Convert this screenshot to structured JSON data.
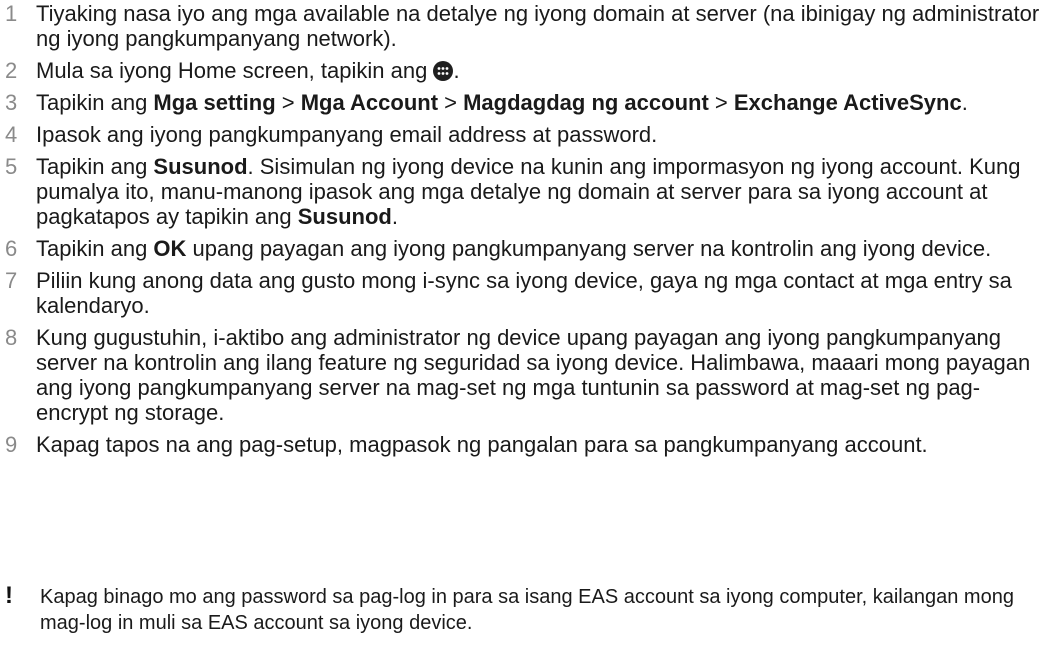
{
  "steps": [
    {
      "num": "1",
      "parts": [
        {
          "t": "Tiyaking nasa iyo ang mga available na detalye ng iyong domain at server (na ibinigay ng administrator ng iyong pangkumpanyang network)."
        }
      ]
    },
    {
      "num": "2",
      "parts": [
        {
          "t": "Mula sa iyong Home screen, tapikin ang "
        },
        {
          "icon": "apps-icon"
        },
        {
          "t": "."
        }
      ]
    },
    {
      "num": "3",
      "parts": [
        {
          "t": "Tapikin ang "
        },
        {
          "b": "Mga setting"
        },
        {
          "t": " > "
        },
        {
          "b": "Mga Account"
        },
        {
          "t": " > "
        },
        {
          "b": "Magdagdag ng account"
        },
        {
          "t": " > "
        },
        {
          "b": "Exchange ActiveSync"
        },
        {
          "t": "."
        }
      ]
    },
    {
      "num": "4",
      "parts": [
        {
          "t": "Ipasok ang iyong pangkumpanyang email address at password."
        }
      ]
    },
    {
      "num": "5",
      "parts": [
        {
          "t": "Tapikin ang "
        },
        {
          "b": "Susunod"
        },
        {
          "t": ". Sisimulan ng iyong device na kunin ang impormasyon ng iyong account. Kung pumalya ito, manu-manong ipasok ang mga detalye ng domain at server para sa iyong account at pagkatapos ay tapikin ang "
        },
        {
          "b": "Susunod"
        },
        {
          "t": "."
        }
      ]
    },
    {
      "num": "6",
      "parts": [
        {
          "t": "Tapikin ang "
        },
        {
          "b": "OK"
        },
        {
          "t": " upang payagan ang iyong pangkumpanyang server na kontrolin ang iyong device."
        }
      ]
    },
    {
      "num": "7",
      "parts": [
        {
          "t": "Piliin kung anong data ang gusto mong i-sync sa iyong device, gaya ng mga contact at mga entry sa kalendaryo."
        }
      ]
    },
    {
      "num": "8",
      "parts": [
        {
          "t": "Kung gugustuhin, i-aktibo ang administrator ng device upang payagan ang iyong pangkumpanyang server na kontrolin ang ilang feature ng seguridad sa iyong device. Halimbawa, maaari mong payagan ang iyong pangkumpanyang server na mag-set ng mga tuntunin sa password at mag-set ng pag-encrypt ng storage."
        }
      ]
    },
    {
      "num": "9",
      "parts": [
        {
          "t": "Kapag tapos na ang pag-setup, magpasok ng pangalan para sa pangkumpanyang account."
        }
      ]
    }
  ],
  "note": {
    "icon": "!",
    "text": "Kapag binago mo ang password sa pag-log in para sa isang EAS account sa iyong computer, kailangan mong mag-log in muli sa EAS account sa iyong device."
  }
}
